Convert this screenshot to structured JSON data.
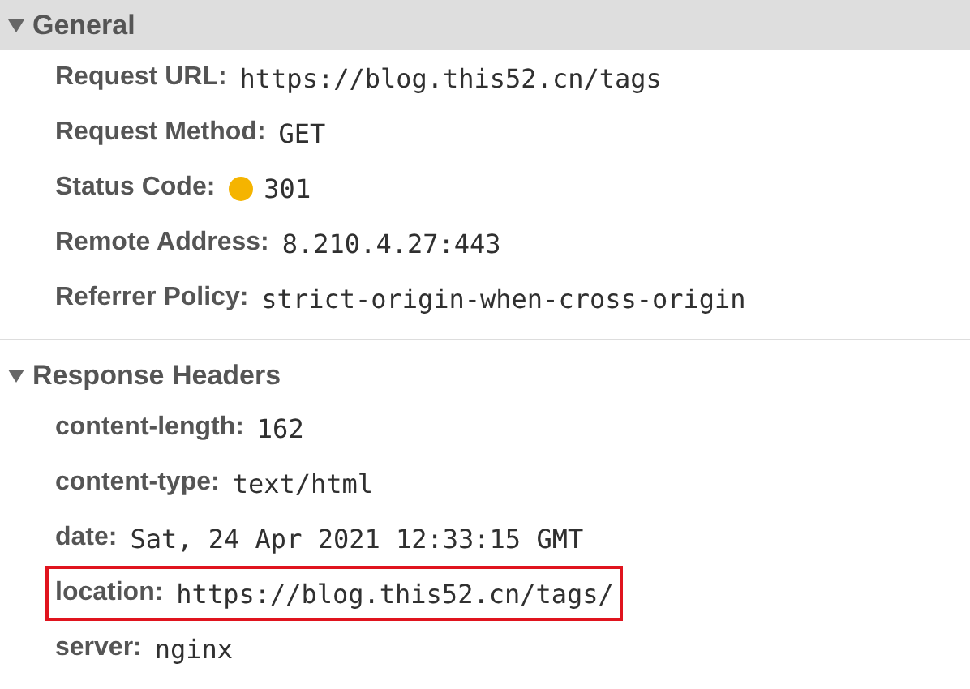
{
  "sections": [
    {
      "title": "General",
      "expanded": true,
      "selected": true,
      "rows": [
        {
          "kind": "plain",
          "name": "Request URL:",
          "value": "https://blog.this52.cn/tags",
          "highlighted": false
        },
        {
          "kind": "plain",
          "name": "Request Method:",
          "value": "GET",
          "highlighted": false
        },
        {
          "kind": "status",
          "name": "Status Code:",
          "value": "301",
          "color": "#f5b400",
          "highlighted": false
        },
        {
          "kind": "plain",
          "name": "Remote Address:",
          "value": "8.210.4.27:443",
          "highlighted": false
        },
        {
          "kind": "plain",
          "name": "Referrer Policy:",
          "value": "strict-origin-when-cross-origin",
          "highlighted": false
        }
      ]
    },
    {
      "title": "Response Headers",
      "expanded": true,
      "selected": false,
      "rows": [
        {
          "kind": "plain",
          "name": "content-length:",
          "value": "162",
          "highlighted": false
        },
        {
          "kind": "plain",
          "name": "content-type:",
          "value": "text/html",
          "highlighted": false
        },
        {
          "kind": "plain",
          "name": "date:",
          "value": "Sat, 24 Apr 2021 12:33:15 GMT",
          "highlighted": false
        },
        {
          "kind": "plain",
          "name": "location:",
          "value": "https://blog.this52.cn/tags/",
          "highlighted": true
        },
        {
          "kind": "plain",
          "name": "server:",
          "value": "nginx",
          "highlighted": false
        }
      ]
    }
  ]
}
